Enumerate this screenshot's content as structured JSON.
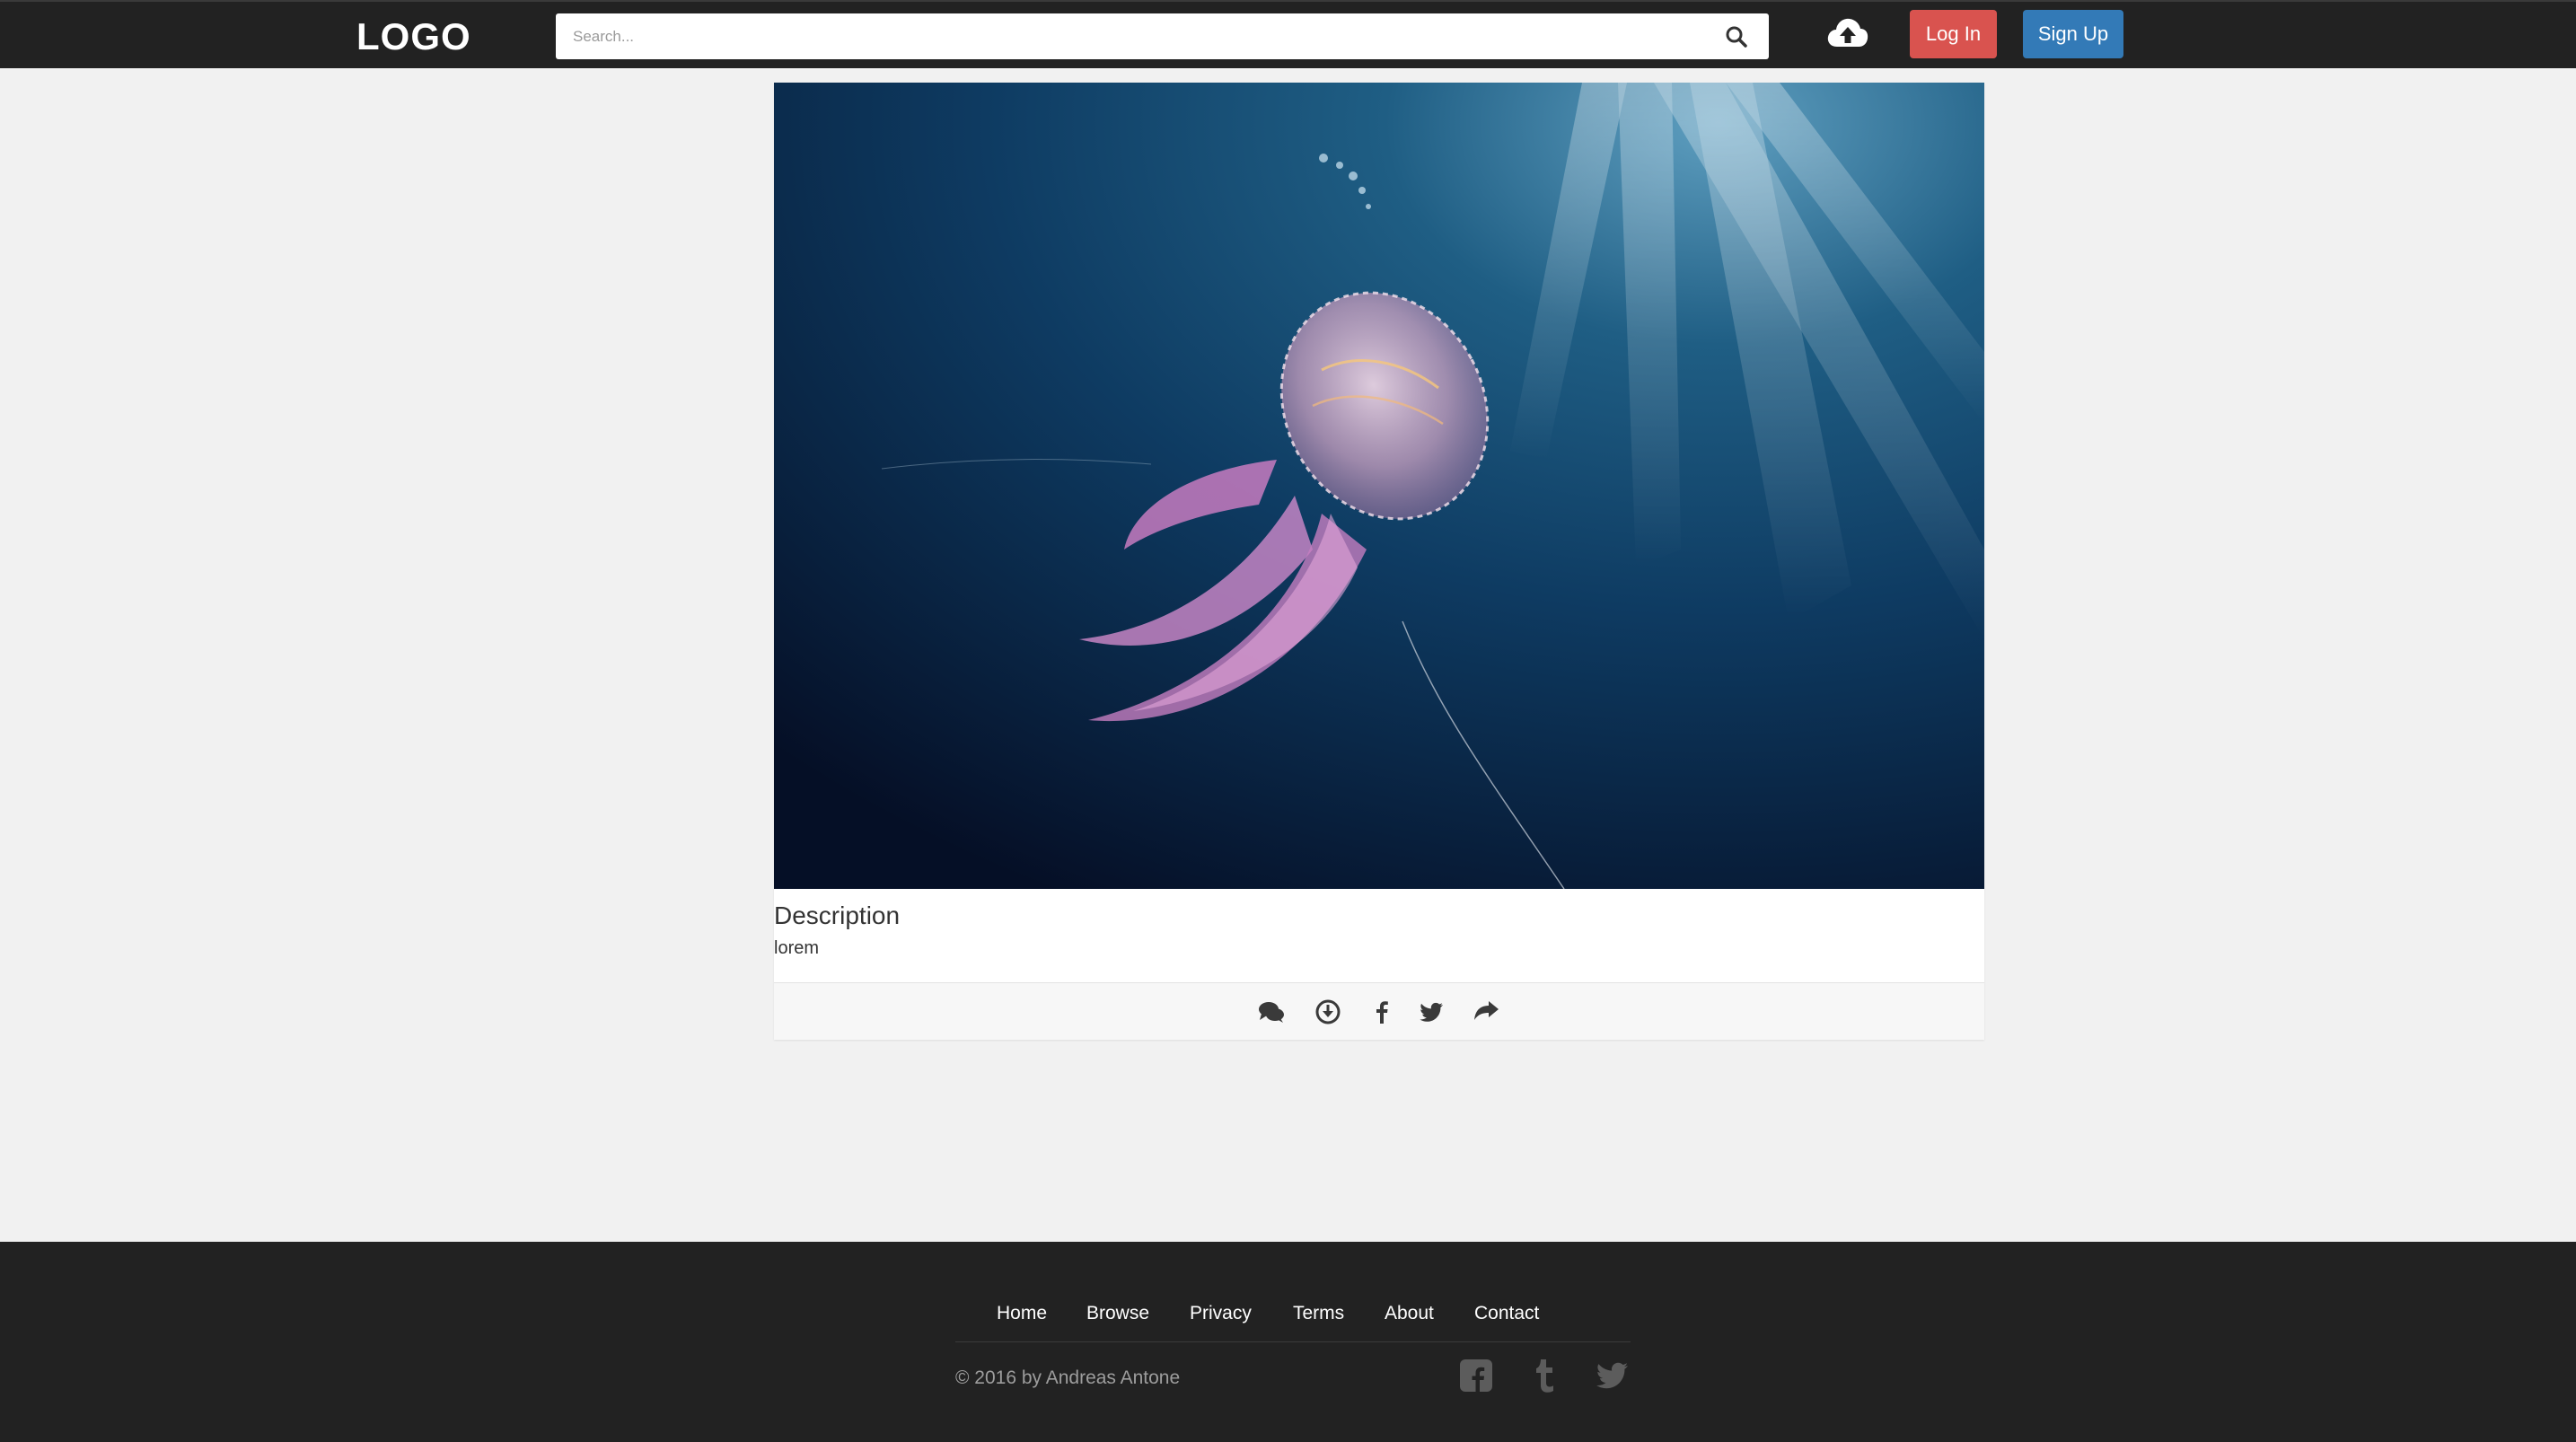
{
  "header": {
    "logo": "LOGO",
    "search_placeholder": "Search...",
    "login_label": "Log In",
    "signup_label": "Sign Up",
    "icons": [
      "search-icon",
      "cloud-upload-icon"
    ],
    "colors": {
      "bar": "#222222",
      "login": "#d9534f",
      "signup": "#337ab7"
    }
  },
  "card": {
    "image_subject": "jellyfish underwater",
    "description_title": "Description",
    "description_text": "lorem",
    "actions": [
      "comments-icon",
      "download-icon",
      "facebook-icon",
      "twitter-icon",
      "share-icon"
    ]
  },
  "footer": {
    "links": [
      "Home",
      "Browse",
      "Privacy",
      "Terms",
      "About",
      "Contact"
    ],
    "copyright": "© 2016 by Andreas Antone",
    "social": [
      "facebook-square-icon",
      "tumblr-icon",
      "twitter-icon"
    ]
  }
}
